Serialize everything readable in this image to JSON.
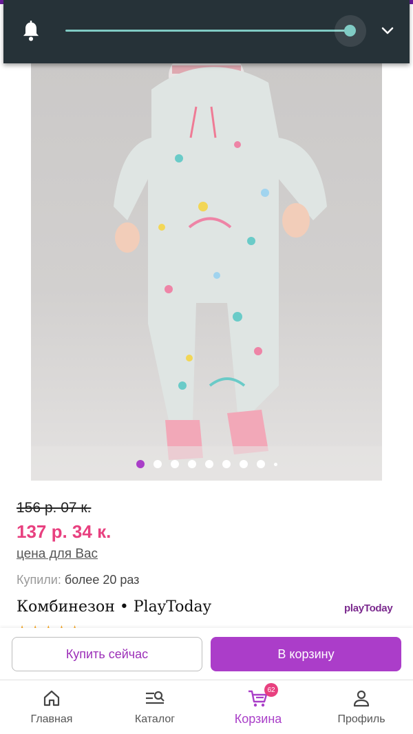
{
  "gallery": {
    "total_images": 9,
    "active_index": 0
  },
  "volume_panel": {
    "level_fraction": 0.97
  },
  "product": {
    "old_price": "156 р. 07 к.",
    "new_price": "137 р. 34 к.",
    "price_note": "цена для Вас",
    "bought_label": "Купили:",
    "bought_value": "более 20 раз",
    "title": "Комбинезон • PlayToday",
    "brand_logo": "playToday",
    "rating_stars": "★★★★★"
  },
  "actions": {
    "buy_now": "Купить сейчас",
    "add_to_cart": "В корзину"
  },
  "nav": {
    "items": [
      {
        "label": "Главная",
        "icon": "home-icon"
      },
      {
        "label": "Каталог",
        "icon": "catalog-icon"
      },
      {
        "label": "Корзина",
        "icon": "cart-icon",
        "badge": "62"
      },
      {
        "label": "Профиль",
        "icon": "profile-icon"
      }
    ]
  },
  "colors": {
    "accent": "#a93ec8",
    "price": "#e8407f",
    "panel": "#263238",
    "slider": "#80cbc4"
  }
}
